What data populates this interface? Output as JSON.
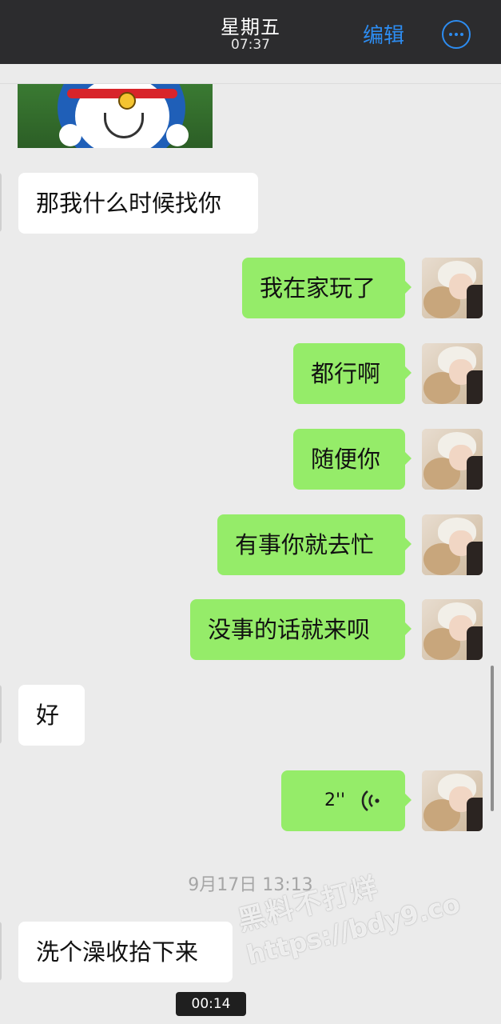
{
  "header": {
    "title": "星期五",
    "time": "07:37",
    "edit_label": "编辑",
    "more_icon": "more-circle-icon"
  },
  "messages": [
    {
      "side": "left",
      "text": "那我什么时候找你"
    },
    {
      "side": "right",
      "text": "我在家玩了"
    },
    {
      "side": "right",
      "text": "都行啊"
    },
    {
      "side": "right",
      "text": "随便你"
    },
    {
      "side": "right",
      "text": "有事你就去忙"
    },
    {
      "side": "right",
      "text": "没事的话就来呗"
    },
    {
      "side": "left",
      "text": "好"
    },
    {
      "side": "right",
      "type": "voice",
      "duration": "2''",
      "icon": "voice-wave-icon"
    },
    {
      "side": "left",
      "text": "洗个澡收拾下来"
    }
  ],
  "timestamp": "9月17日 13:13",
  "video_time": "00:14",
  "watermark": {
    "line1": "黑料不打烊",
    "line2": "https://bdy9.co"
  },
  "colors": {
    "outgoing_bubble": "#95ec69",
    "incoming_bubble": "#ffffff",
    "accent": "#2d8cf0",
    "chat_background": "#ebebeb"
  }
}
